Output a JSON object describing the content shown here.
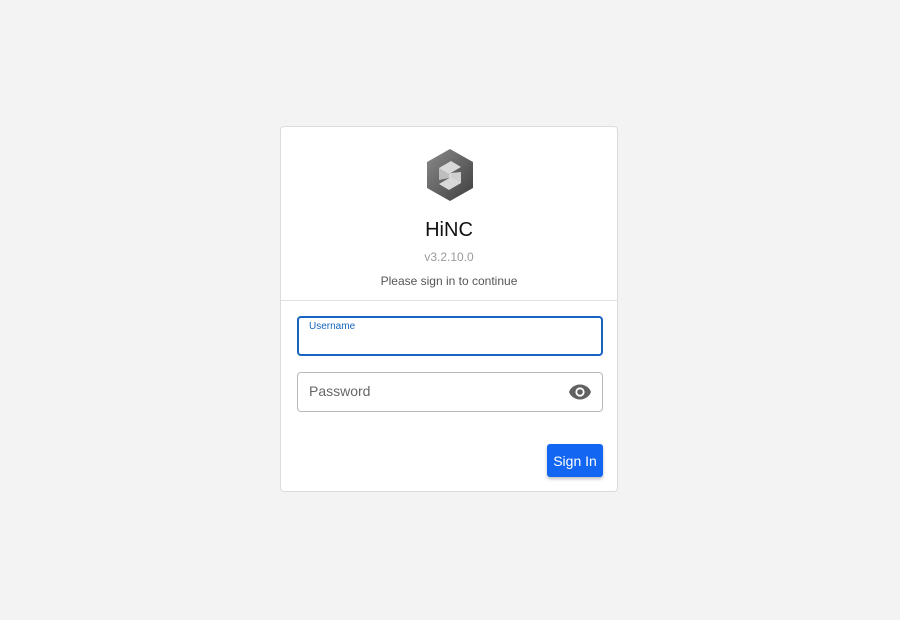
{
  "app": {
    "name": "HiNC",
    "version": "v3.2.10.0",
    "subtitle": "Please sign in to continue",
    "logo_icon": "hexagon-s-logo"
  },
  "form": {
    "username": {
      "label": "Username",
      "value": ""
    },
    "password": {
      "placeholder": "Password",
      "value": "",
      "toggle_icon": "eye-icon"
    },
    "submit_label": "Sign In"
  },
  "colors": {
    "background": "#f3f3f3",
    "accent": "#1565c0",
    "button": "#1266f1"
  }
}
